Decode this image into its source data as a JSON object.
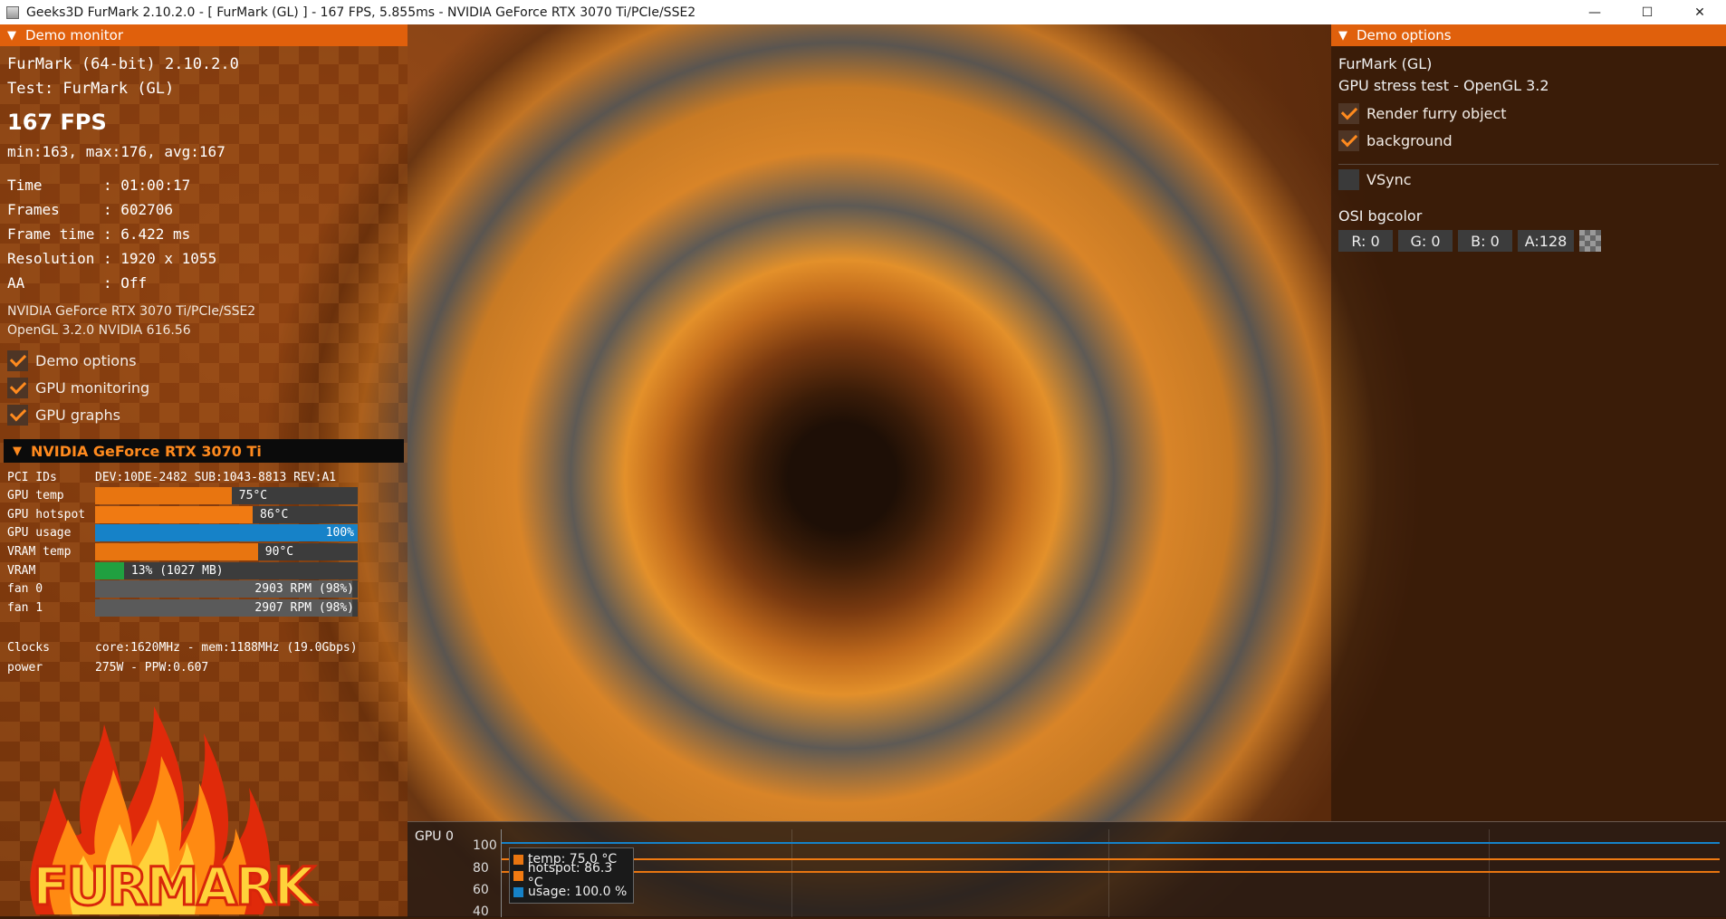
{
  "window": {
    "title": "Geeks3D FurMark 2.10.2.0 - [ FurMark (GL) ] - 167 FPS, 5.855ms - NVIDIA GeForce RTX 3070 Ti/PCIe/SSE2",
    "minimize": "—",
    "maximize": "☐",
    "close": "✕"
  },
  "demo_monitor": {
    "header": "Demo monitor",
    "app_version": "FurMark (64-bit) 2.10.2.0",
    "test": "Test: FurMark (GL)",
    "fps": "167 FPS",
    "fps_stats": "min:163, max:176, avg:167",
    "stats": [
      {
        "label": "Time       : ",
        "value": "01:00:17"
      },
      {
        "label": "Frames     : ",
        "value": "602706"
      },
      {
        "label": "Frame time : ",
        "value": "6.422 ms"
      },
      {
        "label": "Resolution : ",
        "value": "1920 x 1055"
      },
      {
        "label": "AA         : ",
        "value": "Off"
      }
    ],
    "renderer": "NVIDIA GeForce RTX 3070 Ti/PCIe/SSE2",
    "opengl": "OpenGL 3.2.0 NVIDIA 616.56",
    "checkboxes": [
      {
        "label": "Demo options",
        "checked": true
      },
      {
        "label": "GPU monitoring",
        "checked": true
      },
      {
        "label": "GPU graphs",
        "checked": true
      }
    ]
  },
  "gpu_monitor": {
    "header": "NVIDIA GeForce RTX 3070 Ti",
    "pci_label": "PCI IDs",
    "pci_value": "DEV:10DE-2482 SUB:1043-8813 REV:A1",
    "metrics": [
      {
        "label": "GPU temp",
        "value": "75°C",
        "fraction": 0.52,
        "color": "#e87510"
      },
      {
        "label": "GPU hotspot",
        "value": "86°C",
        "fraction": 0.6,
        "color": "#f07a12"
      },
      {
        "label": "GPU usage",
        "value": "100%",
        "fraction": 1.0,
        "color": "#1682c8"
      },
      {
        "label": "VRAM temp",
        "value": "90°C",
        "fraction": 0.62,
        "color": "#e87510"
      },
      {
        "label": "VRAM",
        "value": "13% (1027 MB)",
        "fraction": 0.11,
        "color": "#20a040"
      },
      {
        "label": "fan 0",
        "value": "2903 RPM (98%)",
        "fraction": 0.98,
        "color": "#5a5a5a"
      },
      {
        "label": "fan 1",
        "value": "2907 RPM (98%)",
        "fraction": 0.98,
        "color": "#5a5a5a"
      }
    ],
    "clocks_label": "Clocks",
    "clocks_value": "core:1620MHz - mem:1188MHz (19.0Gbps)",
    "power_label": "power",
    "power_value": "275W - PPW:0.607"
  },
  "logo_text": "FURMARK",
  "demo_options": {
    "header": "Demo options",
    "demo_name": "FurMark (GL)",
    "demo_desc": "GPU stress test - OpenGL 3.2",
    "render_furry": "Render furry object",
    "background": "background",
    "vsync": "VSync",
    "osi_title": "OSI bgcolor",
    "osi": {
      "r": "R: 0",
      "g": "G: 0",
      "b": "B: 0",
      "a": "A:128"
    }
  },
  "gpu_graph": {
    "title": "GPU 0",
    "y_ticks": [
      "100",
      "80",
      "60",
      "40"
    ],
    "legend": [
      {
        "label": "temp: 75.0 °C",
        "color": "#e87510"
      },
      {
        "label": "hotspot: 86.3 °C",
        "color": "#f07a12"
      },
      {
        "label": "usage: 100.0 %",
        "color": "#1682c8"
      }
    ]
  }
}
